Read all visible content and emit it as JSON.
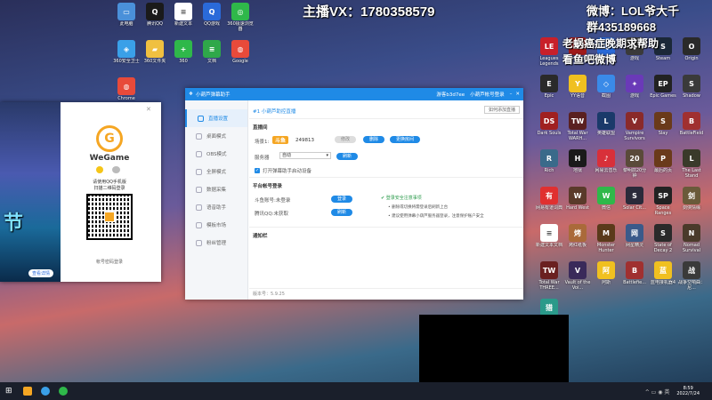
{
  "overlay": {
    "streamer_vx": "主播VX：1780358579",
    "weibo": "微博：LOL爷大千",
    "group": "群435189668",
    "appeal": "老蜗癌症晚期求帮助",
    "follow": "看鱼吧微博",
    "top_right_small": "卓(ctrl)"
  },
  "desktop_left": [
    {
      "label": "此电脑",
      "color": "#4a90d9",
      "g": "▭"
    },
    {
      "label": "腾讯QQ",
      "color": "#1a1a1a",
      "g": "Q"
    },
    {
      "label": "新建文本",
      "color": "#ffffff",
      "g": "≡"
    },
    {
      "label": "QQ游戏",
      "color": "#2a6ad9",
      "g": "Q"
    },
    {
      "label": "360极速浏览器",
      "color": "#2fb84a",
      "g": "◎"
    },
    {
      "label": "360安全卫士",
      "color": "#3aa0e8",
      "g": "◈"
    },
    {
      "label": "360文件夹",
      "color": "#f0c040",
      "g": "▰"
    },
    {
      "label": "360",
      "color": "#2fb84a",
      "g": "+"
    },
    {
      "label": "文档",
      "color": "#2fa84a",
      "g": "≡"
    },
    {
      "label": "Google",
      "color": "#e84a3a",
      "g": "◍"
    },
    {
      "label": "Chrome",
      "color": "#e84a3a",
      "g": "◍"
    }
  ],
  "desktop_right": [
    {
      "label": "Leagues Legends",
      "color": "#c8202a",
      "g": "LE"
    },
    {
      "label": "Legends",
      "color": "#a01a1a",
      "g": "LE"
    },
    {
      "label": "QQ游戏",
      "color": "#2a6ad9",
      "g": "Q"
    },
    {
      "label": "游戏",
      "color": "#3a3a3a",
      "g": "◆"
    },
    {
      "label": "Steam",
      "color": "#1b2838",
      "g": "S"
    },
    {
      "label": "Origin",
      "color": "#2a2a2a",
      "g": "O"
    },
    {
      "label": "Epic",
      "color": "#2a2a2a",
      "g": "E"
    },
    {
      "label": "YY语音",
      "color": "#f0c020",
      "g": "Y"
    },
    {
      "label": "截图",
      "color": "#3a8ae8",
      "g": "◇"
    },
    {
      "label": "游戏",
      "color": "#6a3ab8",
      "g": "✦"
    },
    {
      "label": "Epic Games",
      "color": "#222",
      "g": "EP"
    },
    {
      "label": "Shadow",
      "color": "#3a3a3a",
      "g": "S"
    },
    {
      "label": "Dark Souls",
      "color": "#a02020",
      "g": "DS"
    },
    {
      "label": "Total War WARH...",
      "color": "#5a2020",
      "g": "TW"
    },
    {
      "label": "英雄联盟",
      "color": "#1a3a6a",
      "g": "L"
    },
    {
      "label": "Vampire Survivors",
      "color": "#8a2a2a",
      "g": "V"
    },
    {
      "label": "Slay",
      "color": "#6a3a1a",
      "g": "S"
    },
    {
      "label": "BattleField",
      "color": "#a03030",
      "g": "B"
    },
    {
      "label": "Rich",
      "color": "#3a6a8a",
      "g": "R"
    },
    {
      "label": "地狱",
      "color": "#1a1a1a",
      "g": "H"
    },
    {
      "label": "网易云音乐",
      "color": "#d8303a",
      "g": "♪"
    },
    {
      "label": "黎明前20分钟",
      "color": "#5a4a3a",
      "g": "20"
    },
    {
      "label": "最后的页",
      "color": "#6a3a1a",
      "g": "P"
    },
    {
      "label": "The Last Stand",
      "color": "#3a3a2a",
      "g": "L"
    },
    {
      "label": "网易有道词典",
      "color": "#e03030",
      "g": "有"
    },
    {
      "label": "Hard West",
      "color": "#5a3a2a",
      "g": "W"
    },
    {
      "label": "微信",
      "color": "#2fb84a",
      "g": "W"
    },
    {
      "label": "Solar Cit...",
      "color": "#2a2a3a",
      "g": "S"
    },
    {
      "label": "Space Ranges",
      "color": "#222",
      "g": "SP"
    },
    {
      "label": "剑侠情缘",
      "color": "#6a5a3a",
      "g": "剑"
    },
    {
      "label": "新建文本文档",
      "color": "#ffffff",
      "g": "≡"
    },
    {
      "label": "烤红纸板",
      "color": "#aa6a3a",
      "g": "烤"
    },
    {
      "label": "Monster Hunter",
      "color": "#5a3a1a",
      "g": "M"
    },
    {
      "label": "网星精灵",
      "color": "#3a5a8a",
      "g": "网"
    },
    {
      "label": "State of Decay 2",
      "color": "#2a2a2a",
      "g": "S"
    },
    {
      "label": "Nomad Survival",
      "color": "#4a3a2a",
      "g": "N"
    },
    {
      "label": "Total War THREE...",
      "color": "#6a2020",
      "g": "TW"
    },
    {
      "label": "Vault of the Voi...",
      "color": "#3a2a5a",
      "g": "V"
    },
    {
      "label": "阿斯",
      "color": "#f0c020",
      "g": "阿"
    },
    {
      "label": "Battlefie...",
      "color": "#a03030",
      "g": "B"
    },
    {
      "label": "蓝电接机器4",
      "color": "#f0c020",
      "g": "蓝"
    },
    {
      "label": "战争交响曲：尼...",
      "color": "#3a3a3a",
      "g": "战"
    },
    {
      "label": "猎荒助手无限服...",
      "color": "#2a9a8a",
      "g": "猎"
    }
  ],
  "app": {
    "title": "小葫芦弹幕助手",
    "user": "游客b3d7ee",
    "account": "小葫芦帐号登录",
    "sidebar": [
      {
        "label": "直播设置"
      },
      {
        "label": "桌面模式"
      },
      {
        "label": "OBS模式"
      },
      {
        "label": "全屏模式"
      },
      {
        "label": "数据采集"
      },
      {
        "label": "语音助手"
      },
      {
        "label": "模板市场"
      },
      {
        "label": "粉丝管理"
      }
    ],
    "breadcrumb": "#1 小葫芦助控直播",
    "howto": "如何添加直播",
    "live_section": "直播间",
    "room_label": "场景1:",
    "platform": "斗鱼",
    "room_id": "249813",
    "btn_edit": "修改",
    "btn_delete": "删除",
    "btn_more": "更换房间",
    "server_label": "服务器",
    "server_value": "自动",
    "btn_refresh": "刷新",
    "checkbox_label": "打开弹幕助手启动设备",
    "account_section": "平台帐号登录",
    "douyu_label": "斗鱼账号:",
    "douyu_status": "未登录",
    "douyu_btn": "登录",
    "qq_label": "腾讯QQ:",
    "qq_status": "未获取",
    "qq_btn": "刷新",
    "safety_title": "登录安全注意事项",
    "safety_1": "删除或切换将需登录后刷新上台",
    "safety_2": "建议使用弹幕小葫芦服务器登录，注意保护账户安全",
    "notice_section": "通知栏",
    "version": "版本号：5.9.25"
  },
  "wegame": {
    "brand": "WeGame",
    "scan_text": "请使用QQ手机版",
    "scan_sub": "扫描二维码登录",
    "footer": "帐号密码登录",
    "left_btn": "查看详情",
    "big_text": "节"
  },
  "taskbar": {
    "time": "8:59",
    "date": "2022/7/24"
  }
}
